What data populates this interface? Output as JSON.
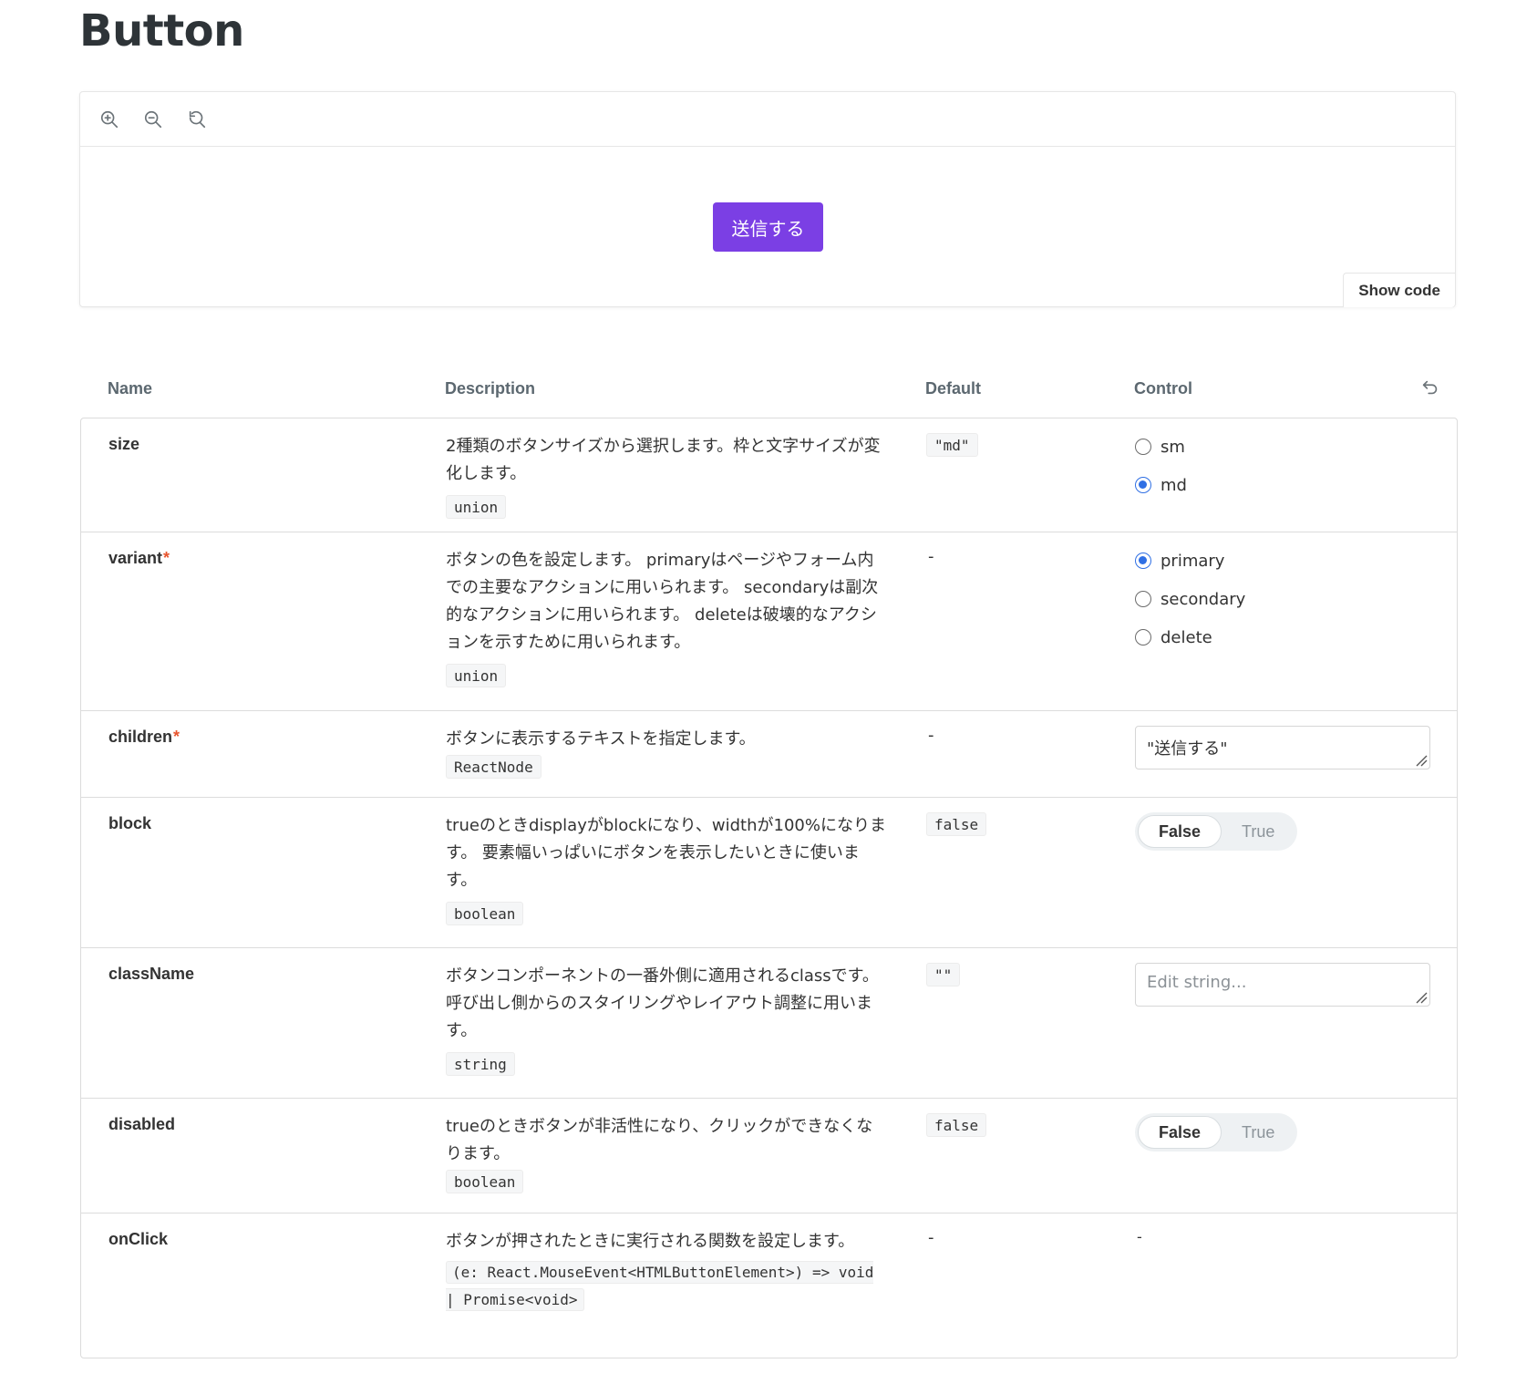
{
  "page": {
    "title": "Button"
  },
  "preview": {
    "tools": [
      "zoom-in-icon",
      "zoom-out-icon",
      "reset-zoom-icon"
    ],
    "button_label": "送信する",
    "button_color": "#7b3fe4",
    "show_code_label": "Show code"
  },
  "table": {
    "headers": {
      "name": "Name",
      "description": "Description",
      "default": "Default",
      "control": "Control"
    },
    "rows": [
      {
        "name": "size",
        "description": "2種類のボタンサイズから選択します。枠と文字サイズが変化します。",
        "type": "union",
        "default": "\"md\"",
        "control": {
          "options": [
            "sm",
            "md"
          ],
          "selected": "md"
        }
      },
      {
        "name": "variant",
        "required_mark": "*",
        "description": "ボタンの色を設定します。 primaryはページやフォーム内での主要なアクションに用いられます。 secondaryは副次的なアクションに用いられます。 deleteは破壊的なアクションを示すために用いられます。",
        "type": "union",
        "default": "-",
        "control": {
          "options": [
            "primary",
            "secondary",
            "delete"
          ],
          "selected": "primary"
        }
      },
      {
        "name": "children",
        "required_mark": "*",
        "description": "ボタンに表示するテキストを指定します。",
        "type": "ReactNode",
        "default": "-",
        "control": {
          "value": "\"送信する\""
        }
      },
      {
        "name": "block",
        "description": "trueのときdisplayがblockになり、widthが100%になります。 要素幅いっぱいにボタンを表示したいときに使います。",
        "type": "boolean",
        "default": "false",
        "control": {
          "false_label": "False",
          "true_label": "True",
          "selected": "False"
        }
      },
      {
        "name": "className",
        "description": "ボタンコンポーネントの一番外側に適用されるclassです。 呼び出し側からのスタイリングやレイアウト調整に用います。",
        "type": "string",
        "default": "\"\"",
        "control": {
          "placeholder": "Edit string..."
        }
      },
      {
        "name": "disabled",
        "description": "trueのときボタンが非活性になり、クリックができなくなります。",
        "type": "boolean",
        "default": "false",
        "control": {
          "false_label": "False",
          "true_label": "True",
          "selected": "False"
        }
      },
      {
        "name": "onClick",
        "description": "ボタンが押されたときに実行される関数を設定します。",
        "type": "(e: React.MouseEvent<HTMLButtonElement>) => void | Promise<void>",
        "default": "-",
        "control": {
          "value": "-"
        }
      }
    ]
  },
  "colors": {
    "radio_selected": "#2f6fe4",
    "required_mark": "#e8552e"
  }
}
